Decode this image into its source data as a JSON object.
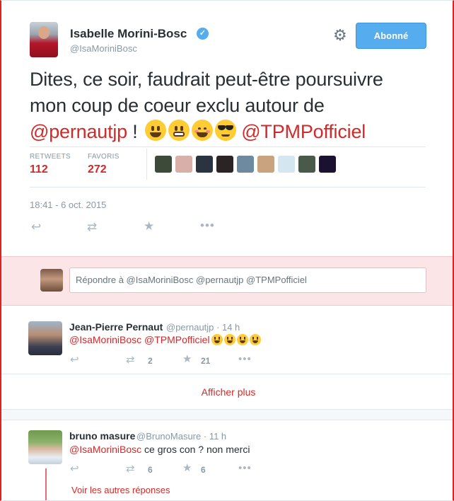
{
  "main_tweet": {
    "author_name": "Isabelle Morini-Bosc",
    "verified_mark": "✓",
    "author_handle": "@IsaMoriniBosc",
    "follow_label": "Abonné",
    "text_line1": "Dites, ce soir, faudrait peut-être poursuivre",
    "text_line2": "mon coup de coeur exclu autour de",
    "mention1": "@pernautjp",
    "text_sep": " ! ",
    "mention2": "@TPMPofficiel",
    "stats": {
      "retweets_label": "RETWEETS",
      "retweets_value": "112",
      "favoris_label": "FAVORIS",
      "favoris_value": "272"
    },
    "favoriter_avatar_colors": [
      "#3d4a3a",
      "#d8b0a8",
      "#2a3440",
      "#2b2424",
      "#6e8aa0",
      "#c9a27e",
      "#d4e6f0",
      "#4a5a4a",
      "#1a1230"
    ],
    "timestamp": "18:41 - 6 oct. 2015",
    "icons": [
      "reply-icon",
      "retweet-icon",
      "favorite-icon",
      "more-icon"
    ]
  },
  "reply_box": {
    "placeholder": "Répondre à @IsaMoriniBosc @pernautjp @TPMPofficiel"
  },
  "replies": [
    {
      "name": "Jean-Pierre Pernaut",
      "handle": "@pernautjp",
      "time": "· 14 h",
      "text": "@IsaMoriniBosc @TPMPofficiel",
      "retweets": "2",
      "favorites": "21"
    },
    {
      "name": "bruno masure",
      "handle": "@BrunoMasure",
      "time": "· 11 h",
      "mention": "@IsaMoriniBosc",
      "text": " ce gros con ? non merci",
      "retweets": "6",
      "favorites": "6"
    }
  ],
  "show_more_label": "Afficher plus",
  "other_replies_label": "Voir les autres réponses",
  "colors": {
    "accent": "#d22a2a",
    "follow_button": "#55acee",
    "reply_bar_bg": "#fbe5e6"
  }
}
